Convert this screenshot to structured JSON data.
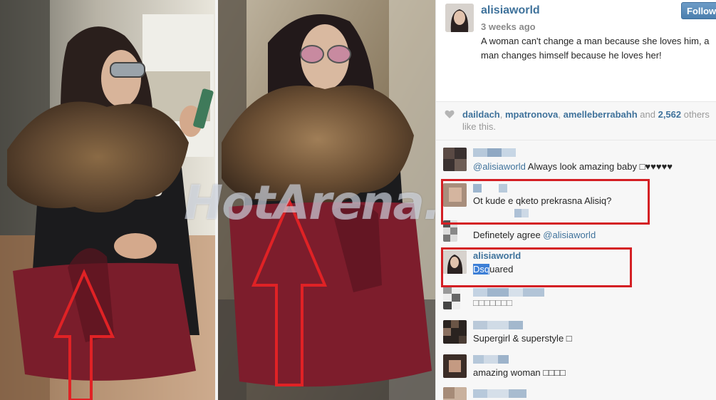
{
  "watermark": "HotArena.net",
  "post": {
    "username": "alisiaworld",
    "time_ago": "3 weeks ago",
    "caption": "A woman can't change a man because she loves him, a man changes himself because he loves her!",
    "follow_label": "Follow"
  },
  "likes": {
    "user1": "daildach",
    "sep1": ", ",
    "user2": "mpatronova",
    "sep2": ", ",
    "user3": "amelleberrabahh",
    "and_label": " and ",
    "count": "2,562",
    "others_label": " others like this."
  },
  "comments": [
    {
      "text_mention": "@alisiaworld",
      "text_rest": " Always look amazing baby □♥♥♥♥♥"
    },
    {
      "text": "Ot kude e qketo prekrasna Alisiq?"
    },
    {
      "text": "Definetely agree ",
      "text_mention": "@alisiaworld"
    },
    {
      "name": "alisiaworld",
      "text_hl": "Dsq",
      "text_rest": "uared"
    },
    {
      "text": "□□□□□□□"
    },
    {
      "text": "Supergirl & superstyle □"
    },
    {
      "text": "amazing woman □□□□"
    }
  ],
  "colors": {
    "link": "#3f729b",
    "highlight_box": "#d41f24",
    "follow_button": "#4c7fae"
  },
  "icons": {
    "heart": "heart-icon",
    "arrow": "up-arrow-annotation"
  }
}
